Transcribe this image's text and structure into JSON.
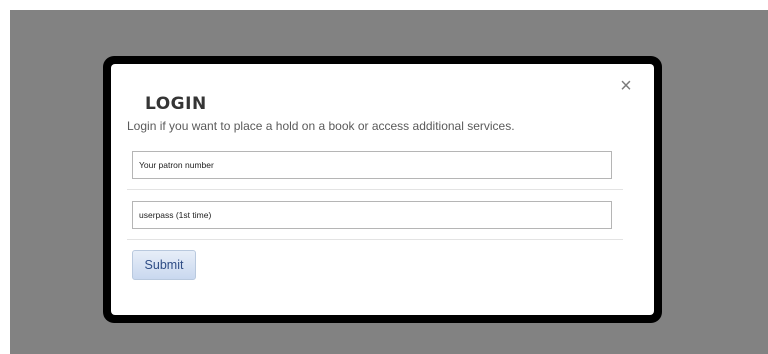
{
  "dialog": {
    "title": "LOGIN",
    "subtitle": "Login if you want to place a hold on a book or access additional services.",
    "close_label": "×",
    "patron_field": {
      "placeholder": "Your patron number",
      "value": ""
    },
    "password_field": {
      "placeholder": "userpass (1st time)",
      "value": ""
    },
    "submit_label": "Submit"
  },
  "colors": {
    "overlay": "#828282",
    "frame": "#000000",
    "submit_text": "#2f4d86"
  }
}
